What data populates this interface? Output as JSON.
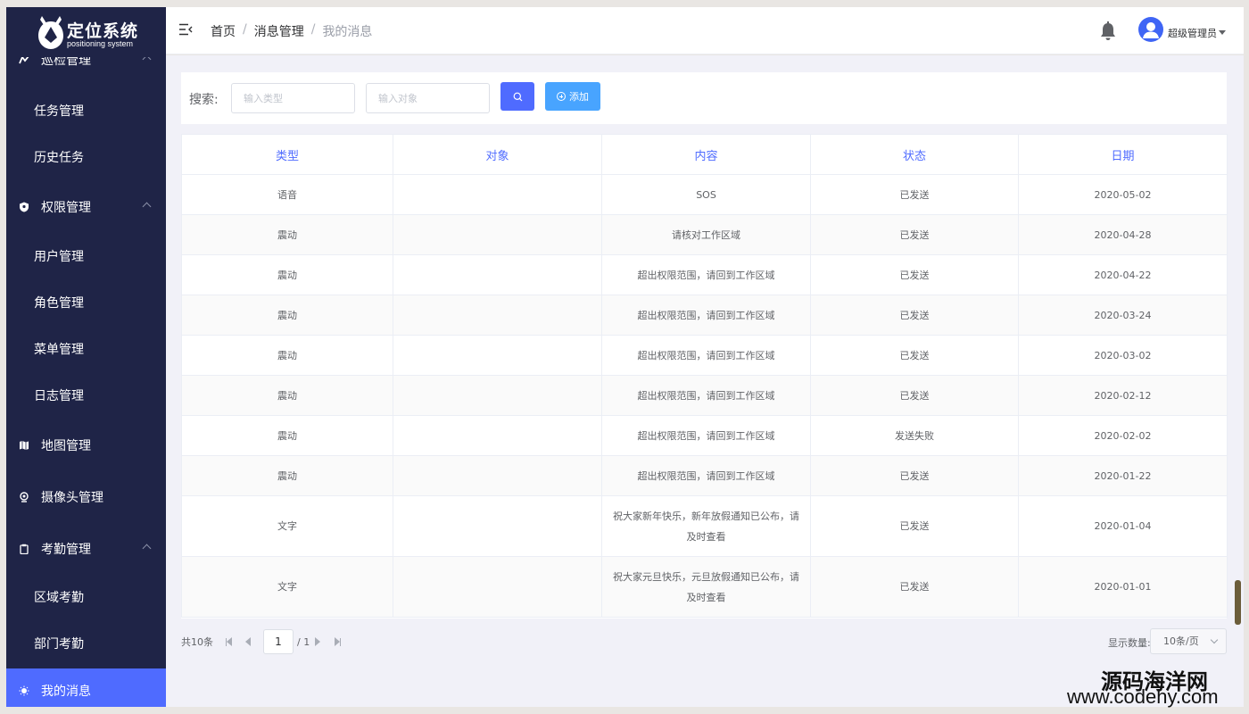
{
  "app": {
    "logo_title": "定位系统",
    "logo_subtitle": "positioning system"
  },
  "sidebar": {
    "items": [
      {
        "label": "巡检管理",
        "type": "parent",
        "icon": "patrol-icon"
      },
      {
        "label": "任务管理",
        "type": "child"
      },
      {
        "label": "历史任务",
        "type": "child"
      },
      {
        "label": "权限管理",
        "type": "parent",
        "icon": "shield-icon"
      },
      {
        "label": "用户管理",
        "type": "child"
      },
      {
        "label": "角色管理",
        "type": "child"
      },
      {
        "label": "菜单管理",
        "type": "child"
      },
      {
        "label": "日志管理",
        "type": "child"
      },
      {
        "label": "地图管理",
        "type": "parent",
        "icon": "map-icon"
      },
      {
        "label": "摄像头管理",
        "type": "parent",
        "icon": "camera-icon"
      },
      {
        "label": "考勤管理",
        "type": "parent",
        "icon": "clipboard-icon"
      },
      {
        "label": "区域考勤",
        "type": "child"
      },
      {
        "label": "部门考勤",
        "type": "child"
      },
      {
        "label": "我的消息",
        "type": "parent",
        "icon": "message-icon",
        "active": true
      }
    ],
    "active_color": "#4f6bff",
    "bg_color": "#1f2447"
  },
  "header": {
    "breadcrumb": [
      "首页",
      "消息管理",
      "我的消息"
    ],
    "user_name": "超级管理员"
  },
  "search": {
    "label": "搜索:",
    "type_placeholder": "输入类型",
    "target_placeholder": "输入对象",
    "add_label": "添加"
  },
  "table": {
    "columns": [
      "类型",
      "对象",
      "内容",
      "状态",
      "日期"
    ],
    "rows": [
      {
        "type": "语音",
        "target": "",
        "content": "SOS",
        "status": "已发送",
        "date": "2020-05-02"
      },
      {
        "type": "震动",
        "target": "",
        "content": "请核对工作区域",
        "status": "已发送",
        "date": "2020-04-28"
      },
      {
        "type": "震动",
        "target": "",
        "content": "超出权限范围，请回到工作区域",
        "status": "已发送",
        "date": "2020-04-22"
      },
      {
        "type": "震动",
        "target": "",
        "content": "超出权限范围，请回到工作区域",
        "status": "已发送",
        "date": "2020-03-24"
      },
      {
        "type": "震动",
        "target": "",
        "content": "超出权限范围，请回到工作区域",
        "status": "已发送",
        "date": "2020-03-02"
      },
      {
        "type": "震动",
        "target": "",
        "content": "超出权限范围，请回到工作区域",
        "status": "已发送",
        "date": "2020-02-12"
      },
      {
        "type": "震动",
        "target": "",
        "content": "超出权限范围，请回到工作区域",
        "status": "发送失败",
        "date": "2020-02-02"
      },
      {
        "type": "震动",
        "target": "",
        "content": "超出权限范围，请回到工作区域",
        "status": "已发送",
        "date": "2020-01-22"
      },
      {
        "type": "文字",
        "target": "",
        "content": "祝大家新年快乐，新年放假通知已公布，请及时查看",
        "status": "已发送",
        "date": "2020-01-04"
      },
      {
        "type": "文字",
        "target": "",
        "content": "祝大家元旦快乐，元旦放假通知已公布，请及时查看",
        "status": "已发送",
        "date": "2020-01-01"
      }
    ]
  },
  "pagination": {
    "total": "共10条",
    "current_page": "1",
    "total_pages": "/ 1",
    "page_size_label": "显示数量:",
    "page_size": "10条/页"
  },
  "watermark": {
    "cn": "源码海洋网",
    "url": "www.codehy.com"
  }
}
